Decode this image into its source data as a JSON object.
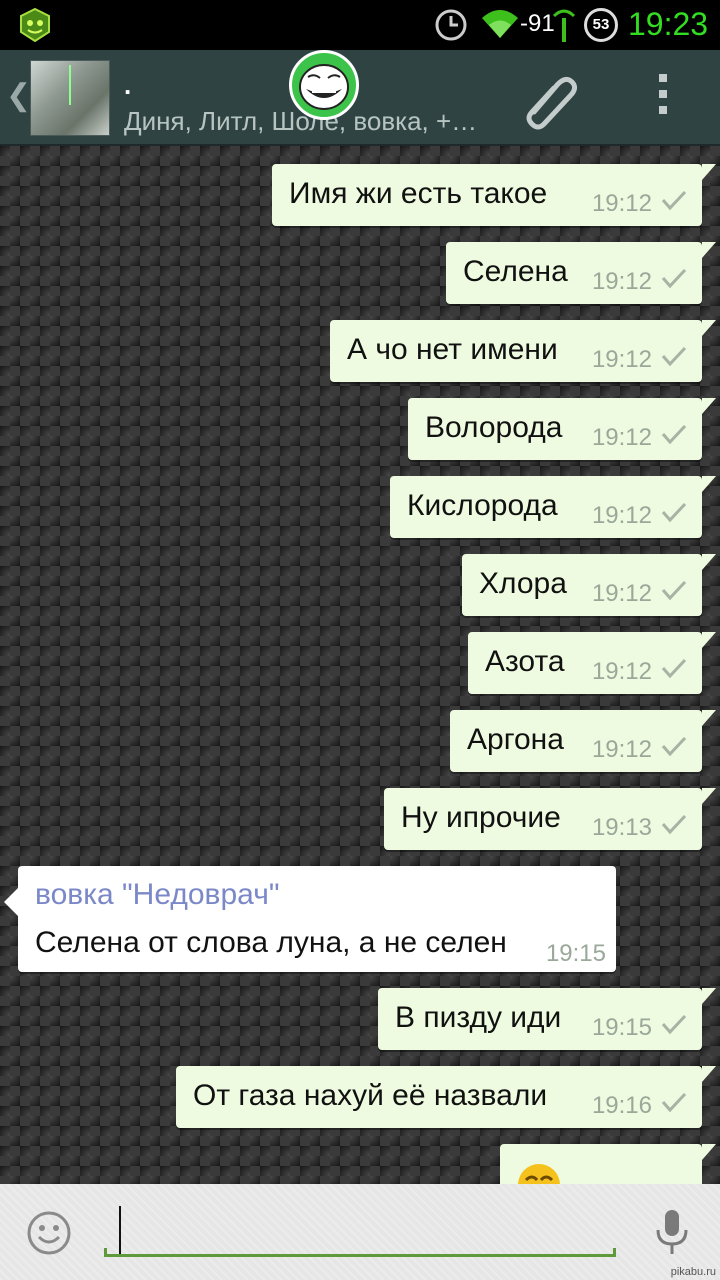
{
  "status_bar": {
    "signal_strength": "-91",
    "battery_level": "53",
    "time": "19:23",
    "time_color": "#33dd22"
  },
  "header": {
    "title": ".",
    "subtitle": "Диня, Литл, Шоле, вовка, +…"
  },
  "messages": [
    {
      "dir": "out",
      "text": "Имя жи есть такое",
      "time": "19:12"
    },
    {
      "dir": "out",
      "text": "Селена",
      "time": "19:12"
    },
    {
      "dir": "out",
      "text": "А чо нет имени",
      "time": "19:12"
    },
    {
      "dir": "out",
      "text": "Волорода",
      "time": "19:12"
    },
    {
      "dir": "out",
      "text": "Кислорода",
      "time": "19:12"
    },
    {
      "dir": "out",
      "text": "Хлора",
      "time": "19:12"
    },
    {
      "dir": "out",
      "text": "Азота",
      "time": "19:12"
    },
    {
      "dir": "out",
      "text": "Аргона",
      "time": "19:12"
    },
    {
      "dir": "out",
      "text": "Ну ипрочие",
      "time": "19:13"
    },
    {
      "dir": "in",
      "sender": "вовка \"Недоврач\"",
      "text": "Селена от слова луна, а не селен",
      "time": "19:15"
    },
    {
      "dir": "out",
      "text": "В пизду иди",
      "time": "19:15"
    },
    {
      "dir": "out",
      "text": "От газа нахуй её назвали",
      "time": "19:16"
    }
  ],
  "input": {
    "value": ""
  },
  "watermark": "pikabu.ru",
  "colors": {
    "header_bg": "#2f4442",
    "outgoing_bubble": "#effbe0",
    "incoming_bubble": "#ffffff",
    "sender_name": "#7b88c8",
    "input_underline": "#5e9a3a"
  }
}
